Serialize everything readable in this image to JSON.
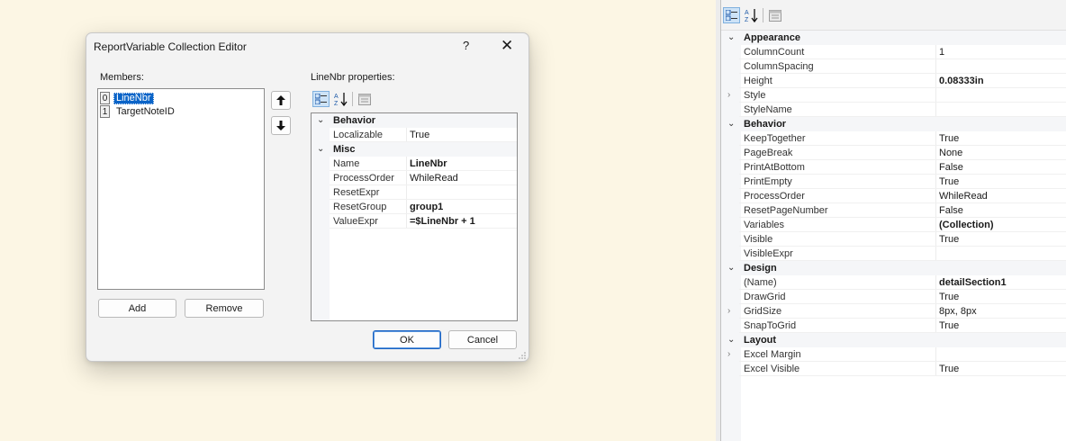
{
  "dialog": {
    "title": "ReportVariable Collection Editor",
    "help": "?",
    "close": "✕",
    "members_label": "Members:",
    "members": [
      {
        "index": "0",
        "name": "LineNbr",
        "selected": true
      },
      {
        "index": "1",
        "name": "TargetNoteID",
        "selected": false
      }
    ],
    "up_icon": "arrow-up",
    "down_icon": "arrow-down",
    "add_label": "Add",
    "remove_label": "Remove",
    "properties_label": "LineNbr properties:",
    "ok_label": "OK",
    "cancel_label": "Cancel",
    "grid": [
      {
        "type": "category",
        "name": "Behavior"
      },
      {
        "type": "prop",
        "label": "Localizable",
        "value": "True",
        "bold": false
      },
      {
        "type": "category",
        "name": "Misc"
      },
      {
        "type": "prop",
        "label": "Name",
        "value": "LineNbr",
        "bold": true
      },
      {
        "type": "prop",
        "label": "ProcessOrder",
        "value": "WhileRead",
        "bold": false
      },
      {
        "type": "prop",
        "label": "ResetExpr",
        "value": "",
        "bold": false
      },
      {
        "type": "prop",
        "label": "ResetGroup",
        "value": "group1",
        "bold": true
      },
      {
        "type": "prop",
        "label": "ValueExpr",
        "value": "=$LineNbr + 1",
        "bold": true
      }
    ]
  },
  "panel": {
    "grid": [
      {
        "type": "category",
        "name": "Appearance"
      },
      {
        "type": "prop",
        "label": "ColumnCount",
        "value": "1",
        "bold": false
      },
      {
        "type": "prop",
        "label": "ColumnSpacing",
        "value": "",
        "bold": false
      },
      {
        "type": "prop",
        "label": "Height",
        "value": "0.08333in",
        "bold": true
      },
      {
        "type": "prop",
        "label": "Style",
        "value": "",
        "bold": false,
        "expandable": true
      },
      {
        "type": "prop",
        "label": "StyleName",
        "value": "",
        "bold": false
      },
      {
        "type": "category",
        "name": "Behavior"
      },
      {
        "type": "prop",
        "label": "KeepTogether",
        "value": "True",
        "bold": false
      },
      {
        "type": "prop",
        "label": "PageBreak",
        "value": "None",
        "bold": false
      },
      {
        "type": "prop",
        "label": "PrintAtBottom",
        "value": "False",
        "bold": false
      },
      {
        "type": "prop",
        "label": "PrintEmpty",
        "value": "True",
        "bold": false
      },
      {
        "type": "prop",
        "label": "ProcessOrder",
        "value": "WhileRead",
        "bold": false
      },
      {
        "type": "prop",
        "label": "ResetPageNumber",
        "value": "False",
        "bold": false
      },
      {
        "type": "prop",
        "label": "Variables",
        "value": "(Collection)",
        "bold": true
      },
      {
        "type": "prop",
        "label": "Visible",
        "value": "True",
        "bold": false
      },
      {
        "type": "prop",
        "label": "VisibleExpr",
        "value": "",
        "bold": false
      },
      {
        "type": "category",
        "name": "Design"
      },
      {
        "type": "prop",
        "label": "(Name)",
        "value": "detailSection1",
        "bold": true
      },
      {
        "type": "prop",
        "label": "DrawGrid",
        "value": "True",
        "bold": false
      },
      {
        "type": "prop",
        "label": "GridSize",
        "value": "8px, 8px",
        "bold": false,
        "expandable": true
      },
      {
        "type": "prop",
        "label": "SnapToGrid",
        "value": "True",
        "bold": false
      },
      {
        "type": "category",
        "name": "Layout"
      },
      {
        "type": "prop",
        "label": "Excel Margin",
        "value": "",
        "bold": false,
        "expandable": true
      },
      {
        "type": "prop",
        "label": "Excel Visible",
        "value": "True",
        "bold": false
      }
    ]
  },
  "colors": {
    "background": "#fcf6e4",
    "selection": "#0a64c8",
    "category_bg": "#f5f6f8"
  }
}
